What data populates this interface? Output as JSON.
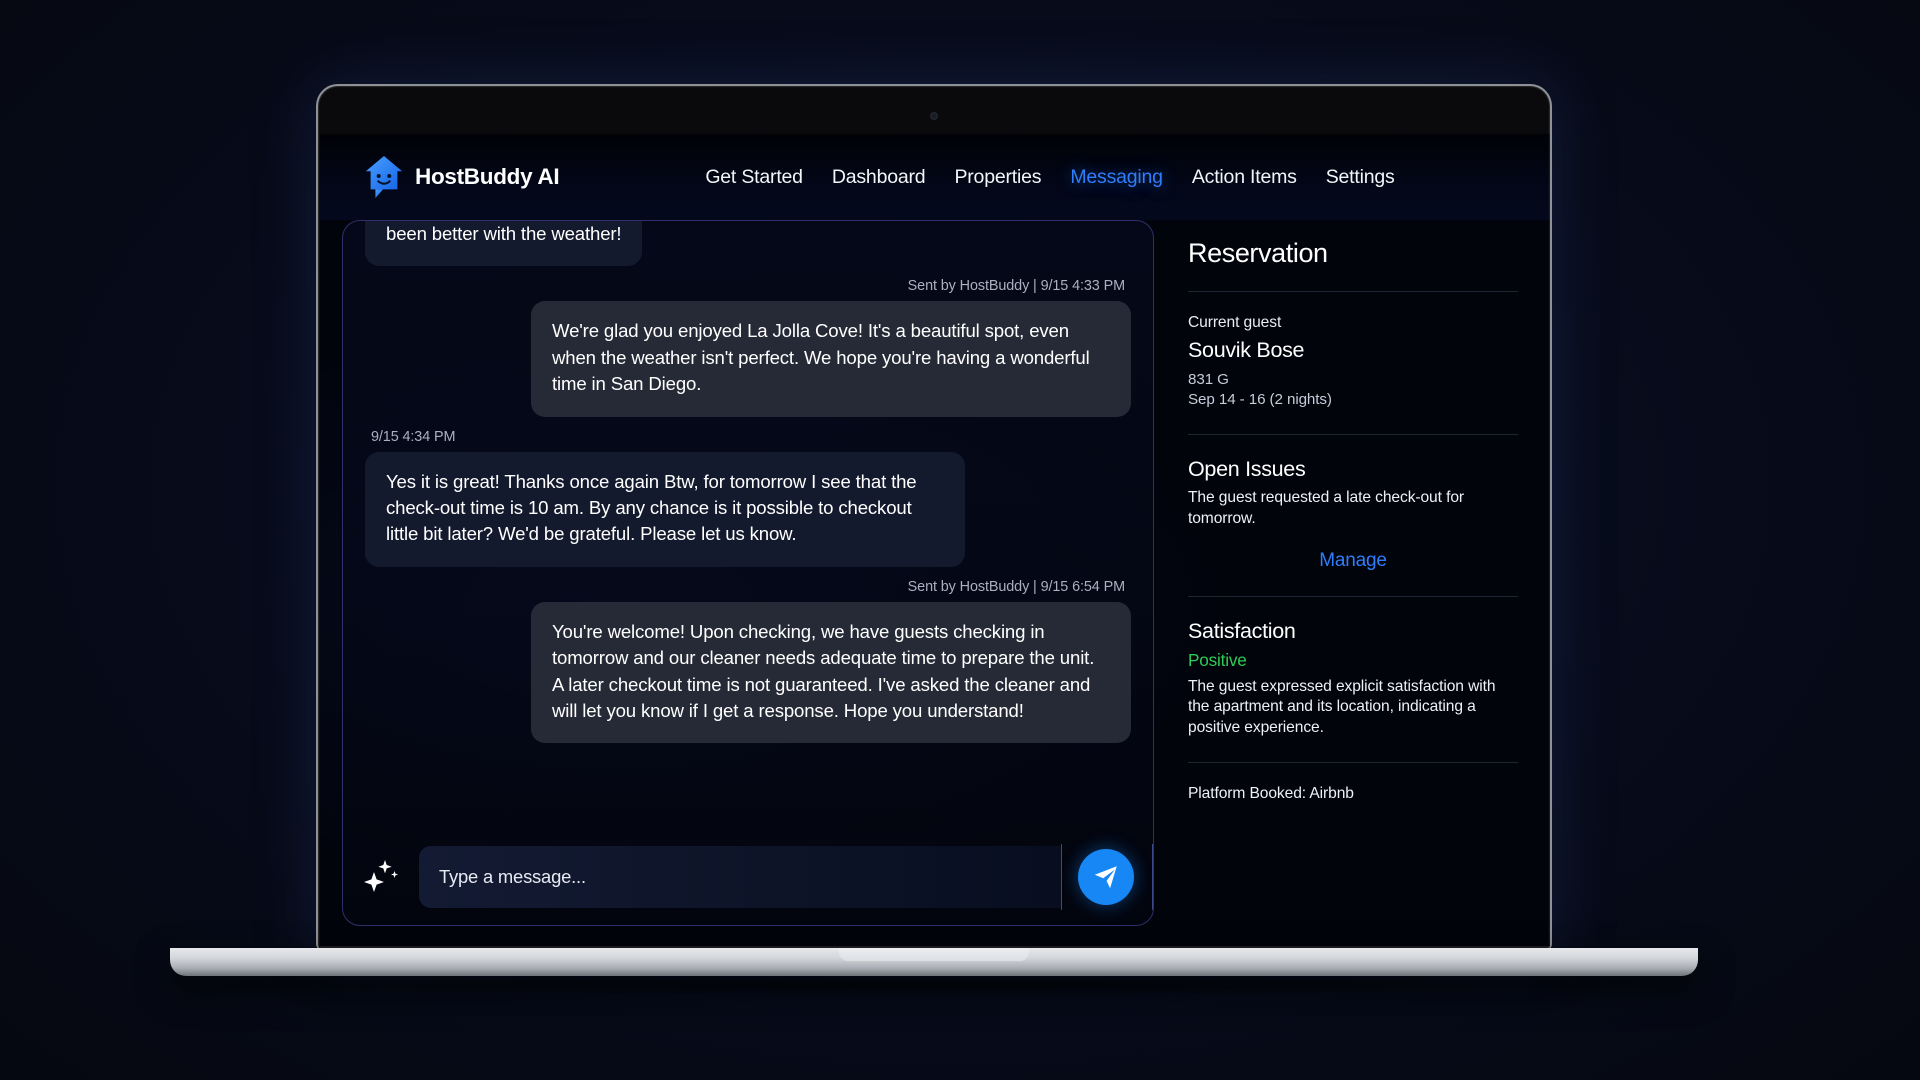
{
  "brand": {
    "name": "HostBuddy AI",
    "logo_icon": "house-chat-smiley-icon"
  },
  "nav": {
    "items": [
      {
        "label": "Get Started",
        "active": false
      },
      {
        "label": "Dashboard",
        "active": false
      },
      {
        "label": "Properties",
        "active": false
      },
      {
        "label": "Messaging",
        "active": true
      },
      {
        "label": "Action Items",
        "active": false
      },
      {
        "label": "Settings",
        "active": false
      }
    ],
    "active_color": "#2f7dfb"
  },
  "chat": {
    "messages": [
      {
        "direction": "in",
        "clipped": true,
        "stamp": "",
        "text": "been better with the weather!"
      },
      {
        "direction": "out",
        "clipped": false,
        "stamp": "Sent by HostBuddy  | 9/15 4:33 PM",
        "text": "We're glad you enjoyed La Jolla Cove! It's a beautiful spot, even when the weather isn't perfect. We hope you're having a wonderful time in San Diego."
      },
      {
        "direction": "in",
        "clipped": false,
        "stamp": "9/15 4:34 PM",
        "text": "Yes it is great! Thanks once again  Btw, for tomorrow I see that the check-out time is 10 am. By any chance is it possible to checkout little bit later? We'd be grateful. Please let us know."
      },
      {
        "direction": "out",
        "clipped": false,
        "stamp": "Sent by HostBuddy  | 9/15 6:54 PM",
        "text": "You're welcome! Upon checking, we have guests checking in tomorrow and our cleaner needs adequate time to prepare the unit. A later checkout time is not guaranteed. I've asked the cleaner and will let you know if I get a response. Hope you understand!"
      }
    ]
  },
  "composer": {
    "ai_icon": "sparkle-icon",
    "input_value": "",
    "placeholder": "Type a message...",
    "send_icon": "send-paper-plane-icon",
    "send_color": "#1787f5"
  },
  "reservation": {
    "title": "Reservation",
    "current_guest_label": "Current guest",
    "guest_name": "Souvik Bose",
    "unit": "831 G",
    "dates": "Sep 14 - 16 (2 nights)",
    "open_issues": {
      "heading": "Open Issues",
      "text": "The guest requested a late check-out for tomorrow.",
      "action_label": "Manage"
    },
    "satisfaction": {
      "heading": "Satisfaction",
      "status": "Positive",
      "status_color": "#2ecc55",
      "text": "The guest expressed explicit satisfaction with the apartment and its location, indicating a positive experience."
    },
    "platform": "Platform Booked: Airbnb"
  }
}
